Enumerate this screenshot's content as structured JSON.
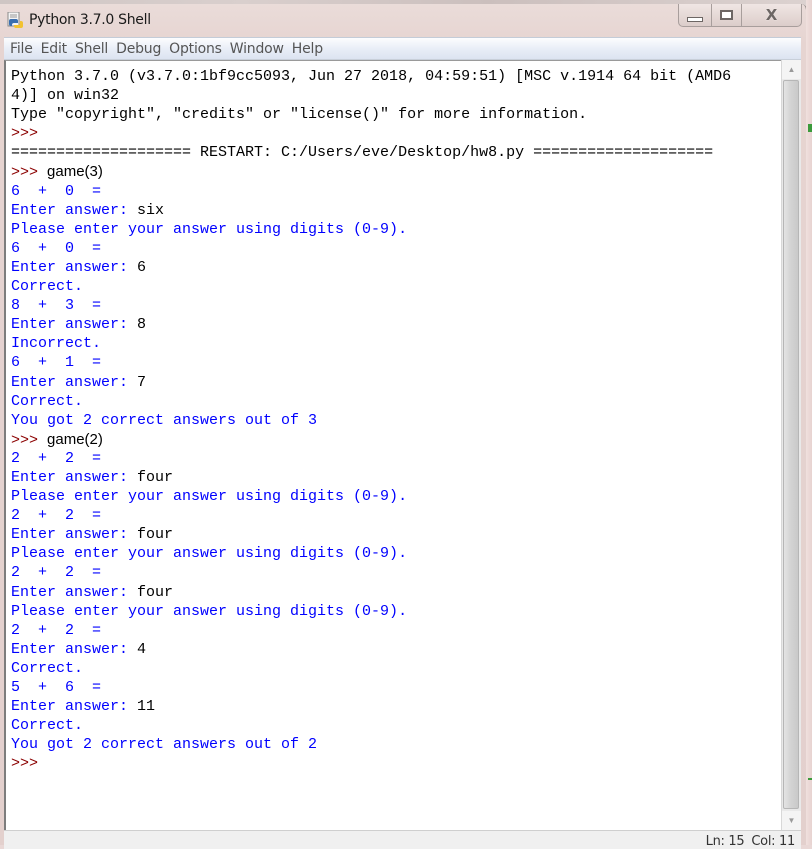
{
  "window": {
    "title": "Python 3.7.0 Shell",
    "icon": "python-idle-icon",
    "controls": {
      "minimize": "minimize-icon",
      "maximize": "maximize-icon",
      "close": "close-icon",
      "close_glyph": "X"
    }
  },
  "menubar": {
    "items": [
      "File",
      "Edit",
      "Shell",
      "Debug",
      "Options",
      "Window",
      "Help"
    ]
  },
  "colors": {
    "stdout": "#0000ff",
    "stdin": "#000000",
    "prompt": "#8b0000",
    "plain": "#000000"
  },
  "shell": {
    "lines": [
      [
        {
          "t": "Python 3.7.0 (v3.7.0:1bf9cc5093, Jun 27 2018, 04:59:51) [MSC v.1914 64 bit (AMD6",
          "c": "plain"
        }
      ],
      [
        {
          "t": "4)] on win32",
          "c": "plain"
        }
      ],
      [
        {
          "t": "Type \"copyright\", \"credits\" or \"license()\" for more information.",
          "c": "plain"
        }
      ],
      [
        {
          "t": ">>> ",
          "c": "prompt"
        }
      ],
      [
        {
          "t": "==================== RESTART: C:/Users/eve/Desktop/hw8.py ====================",
          "c": "plain"
        }
      ],
      [
        {
          "t": ">>> ",
          "c": "prompt"
        },
        {
          "t": "game(3)",
          "c": "cmd"
        }
      ],
      [
        {
          "t": "6  +  0  =",
          "c": "stdout"
        }
      ],
      [
        {
          "t": "Enter answer: ",
          "c": "stdout"
        },
        {
          "t": "six",
          "c": "stdin"
        }
      ],
      [
        {
          "t": "Please enter your answer using digits (0-9).",
          "c": "stdout"
        }
      ],
      [
        {
          "t": "6  +  0  =",
          "c": "stdout"
        }
      ],
      [
        {
          "t": "Enter answer: ",
          "c": "stdout"
        },
        {
          "t": "6",
          "c": "stdin"
        }
      ],
      [
        {
          "t": "Correct.",
          "c": "stdout"
        }
      ],
      [
        {
          "t": "8  +  3  =",
          "c": "stdout"
        }
      ],
      [
        {
          "t": "Enter answer: ",
          "c": "stdout"
        },
        {
          "t": "8",
          "c": "stdin"
        }
      ],
      [
        {
          "t": "Incorrect.",
          "c": "stdout"
        }
      ],
      [
        {
          "t": "6  +  1  =",
          "c": "stdout"
        }
      ],
      [
        {
          "t": "Enter answer: ",
          "c": "stdout"
        },
        {
          "t": "7",
          "c": "stdin"
        }
      ],
      [
        {
          "t": "Correct.",
          "c": "stdout"
        }
      ],
      [
        {
          "t": "You got 2 correct answers out of 3",
          "c": "stdout"
        }
      ],
      [
        {
          "t": ">>> ",
          "c": "prompt"
        },
        {
          "t": "game(2)",
          "c": "cmd"
        }
      ],
      [
        {
          "t": "2  +  2  =",
          "c": "stdout"
        }
      ],
      [
        {
          "t": "Enter answer: ",
          "c": "stdout"
        },
        {
          "t": "four",
          "c": "stdin"
        }
      ],
      [
        {
          "t": "Please enter your answer using digits (0-9).",
          "c": "stdout"
        }
      ],
      [
        {
          "t": "2  +  2  =",
          "c": "stdout"
        }
      ],
      [
        {
          "t": "Enter answer: ",
          "c": "stdout"
        },
        {
          "t": "four",
          "c": "stdin"
        }
      ],
      [
        {
          "t": "Please enter your answer using digits (0-9).",
          "c": "stdout"
        }
      ],
      [
        {
          "t": "2  +  2  =",
          "c": "stdout"
        }
      ],
      [
        {
          "t": "Enter answer: ",
          "c": "stdout"
        },
        {
          "t": "four",
          "c": "stdin"
        }
      ],
      [
        {
          "t": "Please enter your answer using digits (0-9).",
          "c": "stdout"
        }
      ],
      [
        {
          "t": "2  +  2  =",
          "c": "stdout"
        }
      ],
      [
        {
          "t": "Enter answer: ",
          "c": "stdout"
        },
        {
          "t": "4",
          "c": "stdin"
        }
      ],
      [
        {
          "t": "Correct.",
          "c": "stdout"
        }
      ],
      [
        {
          "t": "5  +  6  =",
          "c": "stdout"
        }
      ],
      [
        {
          "t": "Enter answer: ",
          "c": "stdout"
        },
        {
          "t": "11",
          "c": "stdin"
        }
      ],
      [
        {
          "t": "Correct.",
          "c": "stdout"
        }
      ],
      [
        {
          "t": "You got 2 correct answers out of 2",
          "c": "stdout"
        }
      ],
      [
        {
          "t": ">>> ",
          "c": "prompt"
        }
      ]
    ]
  },
  "scrollbar": {
    "up_icon": "scroll-up-arrow-icon",
    "down_icon": "scroll-down-arrow-icon",
    "up_glyph": "▲",
    "down_glyph": "▼"
  },
  "statusbar": {
    "line": "Ln: 15",
    "col": "Col: 11"
  }
}
